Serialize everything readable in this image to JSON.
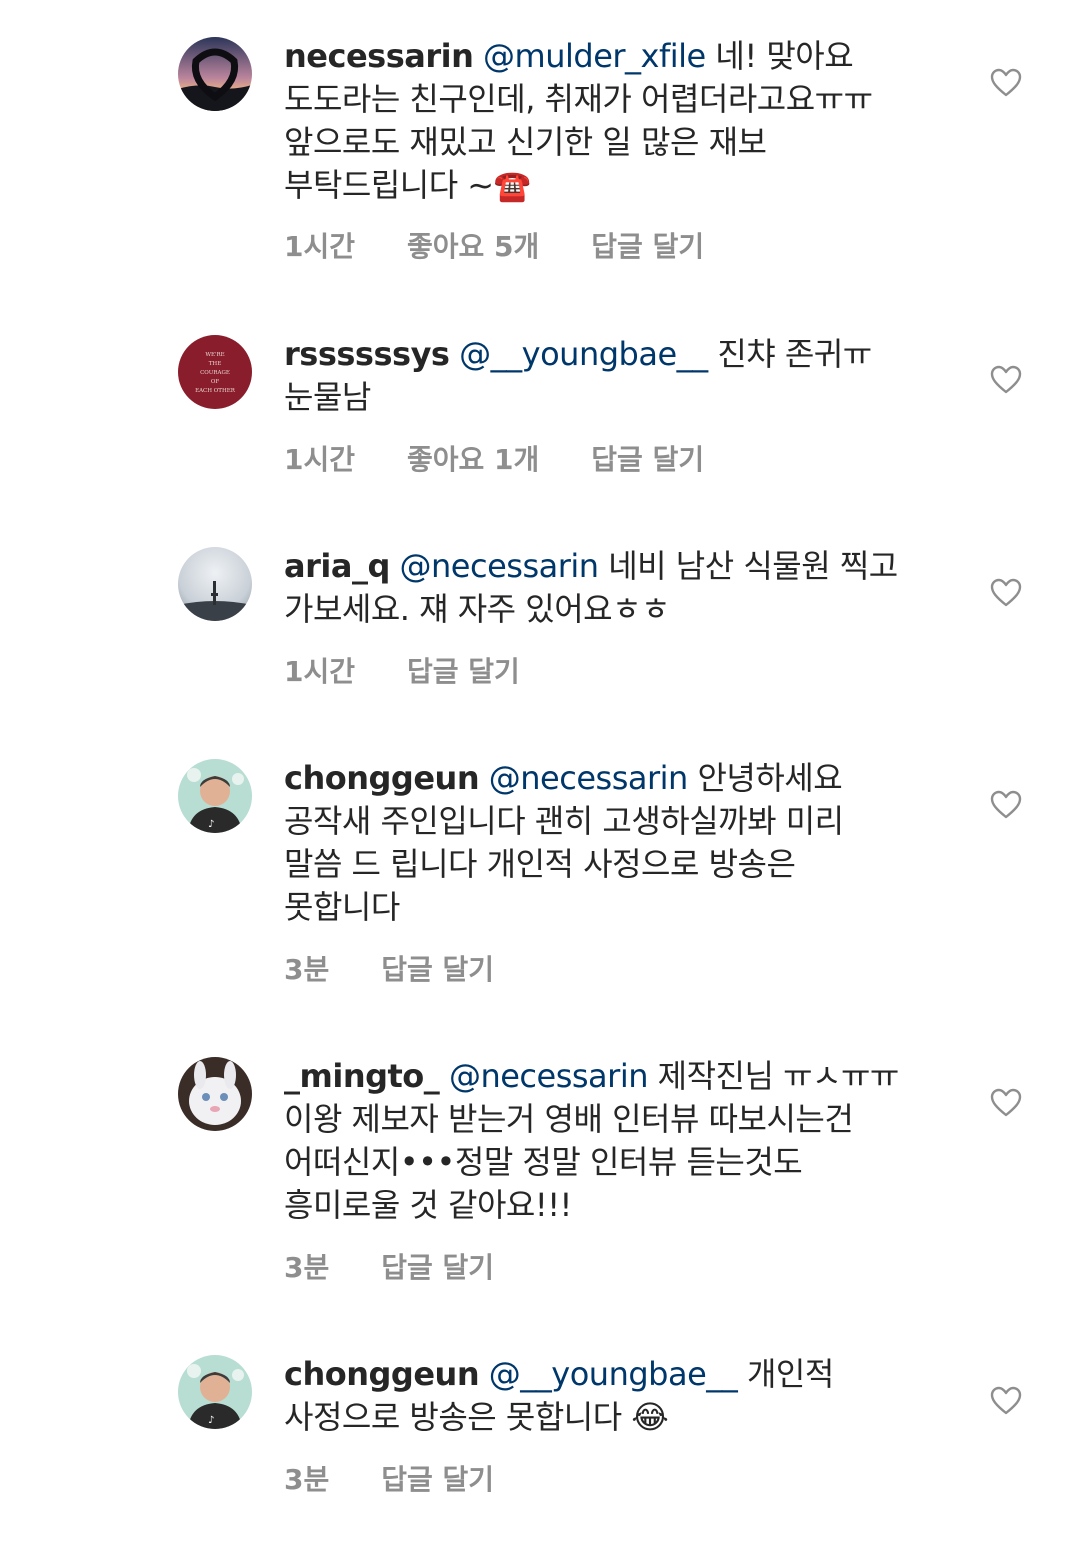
{
  "comments": [
    {
      "username": "necessarin",
      "mention": "@mulder_xfile",
      "lines": [
        "네! 맞아요",
        "도도라는 친구인데, 취재가 어렵더라고요ㅠㅠ",
        "앞으로도 재밌고 신기한 일 많은 재보",
        "부탁드립니다 ~"
      ],
      "emoji": "☎️",
      "time": "1시간",
      "likes": "좋아요 5개",
      "reply": "답글 달기"
    },
    {
      "username": "rssssssys",
      "mention": "@__youngbae__",
      "lines": [
        "진챠 존귀ㅠ",
        "눈물남"
      ],
      "time": "1시간",
      "likes": "좋아요 1개",
      "reply": "답글 달기",
      "avatar_text": [
        "WE'RE",
        "THE",
        "COURAGE",
        "OF",
        "EACH OTHER"
      ]
    },
    {
      "username": "aria_q",
      "mention": "@necessarin",
      "lines": [
        "네비 남산 식물원 찍고",
        "가보세요.  쟤 자주 있어요ㅎㅎ"
      ],
      "time": "1시간",
      "reply": "답글 달기"
    },
    {
      "username": "chonggeun",
      "mention": "@necessarin",
      "lines": [
        "안녕하세요",
        "공작새 주인입니다 괜히 고생하실까봐 미리",
        "말씀 드 립니다 개인적 사정으로 방송은",
        "못합니다"
      ],
      "time": "3분",
      "reply": "답글 달기"
    },
    {
      "username": "_mingto_",
      "mention": "@necessarin",
      "lines": [
        "제작진님 ㅠㅅㅠㅠ",
        "이왕 제보자 받는거 영배 인터뷰 따보시는건",
        "어떠신지•••정말 정말 인터뷰 듣는것도",
        "흥미로울 것 같아요!!!"
      ],
      "time": "3분",
      "reply": "답글 달기"
    },
    {
      "username": "chonggeun",
      "mention": "@__youngbae__",
      "lines": [
        "개인적",
        "사정으로 방송은 못합니다 "
      ],
      "emoji": "😂",
      "time": "3분",
      "reply": "답글 달기"
    }
  ]
}
